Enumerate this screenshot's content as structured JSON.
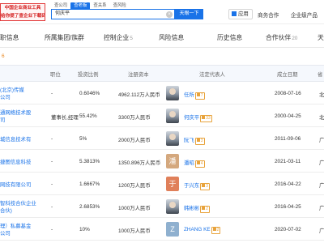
{
  "header": {
    "logo_lines": [
      "中国企业商业工具",
      "给你提了查企业下载码"
    ],
    "search_tabs": [
      "查公司",
      "查老板",
      "查关系",
      "查风险"
    ],
    "active_tab_index": 1,
    "search_value": "何庆平",
    "search_button": "天眼一下",
    "app_button": "应用",
    "links": [
      "商务合作",
      "企业级产品"
    ]
  },
  "categories": [
    {
      "label": "职信息",
      "count": ""
    },
    {
      "label": "所属集团/族群",
      "count": ""
    },
    {
      "label": "控制企业",
      "count": "5"
    },
    {
      "label": "风险信息",
      "count": ""
    },
    {
      "label": "历史信息",
      "count": ""
    },
    {
      "label": "合作伙伴",
      "count": "20"
    },
    {
      "label": "天",
      "count": ""
    }
  ],
  "list_count": "6",
  "table": {
    "headers": [
      "职位",
      "投资比例",
      "注册资本",
      "法定代表人",
      "成立日期",
      "省"
    ],
    "rows": [
      {
        "company": [
          "(北京)传媒",
          "公司"
        ],
        "position": "-",
        "ratio": "0.6046%",
        "capital": "4962.112万人民币",
        "rep": "任所",
        "rep_badge": "7",
        "avatar": "",
        "avatar_color": "",
        "date": "2008-07-16",
        "prov": "北"
      },
      {
        "company": [
          "通网络技术股",
          "司"
        ],
        "position": "董事长,经理",
        "ratio": "55.42%",
        "capital": "3300万人民币",
        "rep": "何庆平",
        "rep_badge": "33",
        "avatar": "",
        "avatar_color": "",
        "date": "2000-04-25",
        "prov": "北"
      },
      {
        "company": [
          "城信息技术有"
        ],
        "position": "-",
        "ratio": "5%",
        "capital": "2000万人民币",
        "rep": "阮飞",
        "rep_badge": "3",
        "avatar": "",
        "avatar_color": "",
        "date": "2011-09-06",
        "prov": "广"
      },
      {
        "company": [
          "捷图信息科技"
        ],
        "position": "-",
        "ratio": "5.3813%",
        "capital": "1350.896万人民币",
        "rep": "潘昭",
        "rep_badge": "4",
        "avatar": "潘",
        "avatar_color": "#d4a87e",
        "date": "2021-03-11",
        "prov": "广"
      },
      {
        "company": [
          "网技有限公司"
        ],
        "position": "-",
        "ratio": "1.6667%",
        "capital": "1200万人民币",
        "rep": "于兴东",
        "rep_badge": "3",
        "avatar": "于",
        "avatar_color": "#e0805a",
        "date": "2016-04-22",
        "prov": "广"
      },
      {
        "company": [
          "智科技合伙企业",
          "合伙)"
        ],
        "position": "-",
        "ratio": "2.6853%",
        "capital": "1000万人民币",
        "rep": "韩彬彬",
        "rep_badge": "2",
        "avatar": "",
        "avatar_color": "",
        "date": "2016-04-25",
        "prov": "广"
      },
      {
        "company": [
          "理）私募基金",
          "公司"
        ],
        "position": "-",
        "ratio": "10%",
        "capital": "1000万人民币",
        "rep": "ZHANG KE",
        "rep_badge": "2",
        "avatar": "Z",
        "avatar_color": "#8fb0cf",
        "date": "2020-07-02",
        "prov": "广"
      }
    ]
  },
  "colors": {
    "accent": "#1a73e8",
    "badge": "#e8a33c",
    "logo": "#d42020"
  }
}
